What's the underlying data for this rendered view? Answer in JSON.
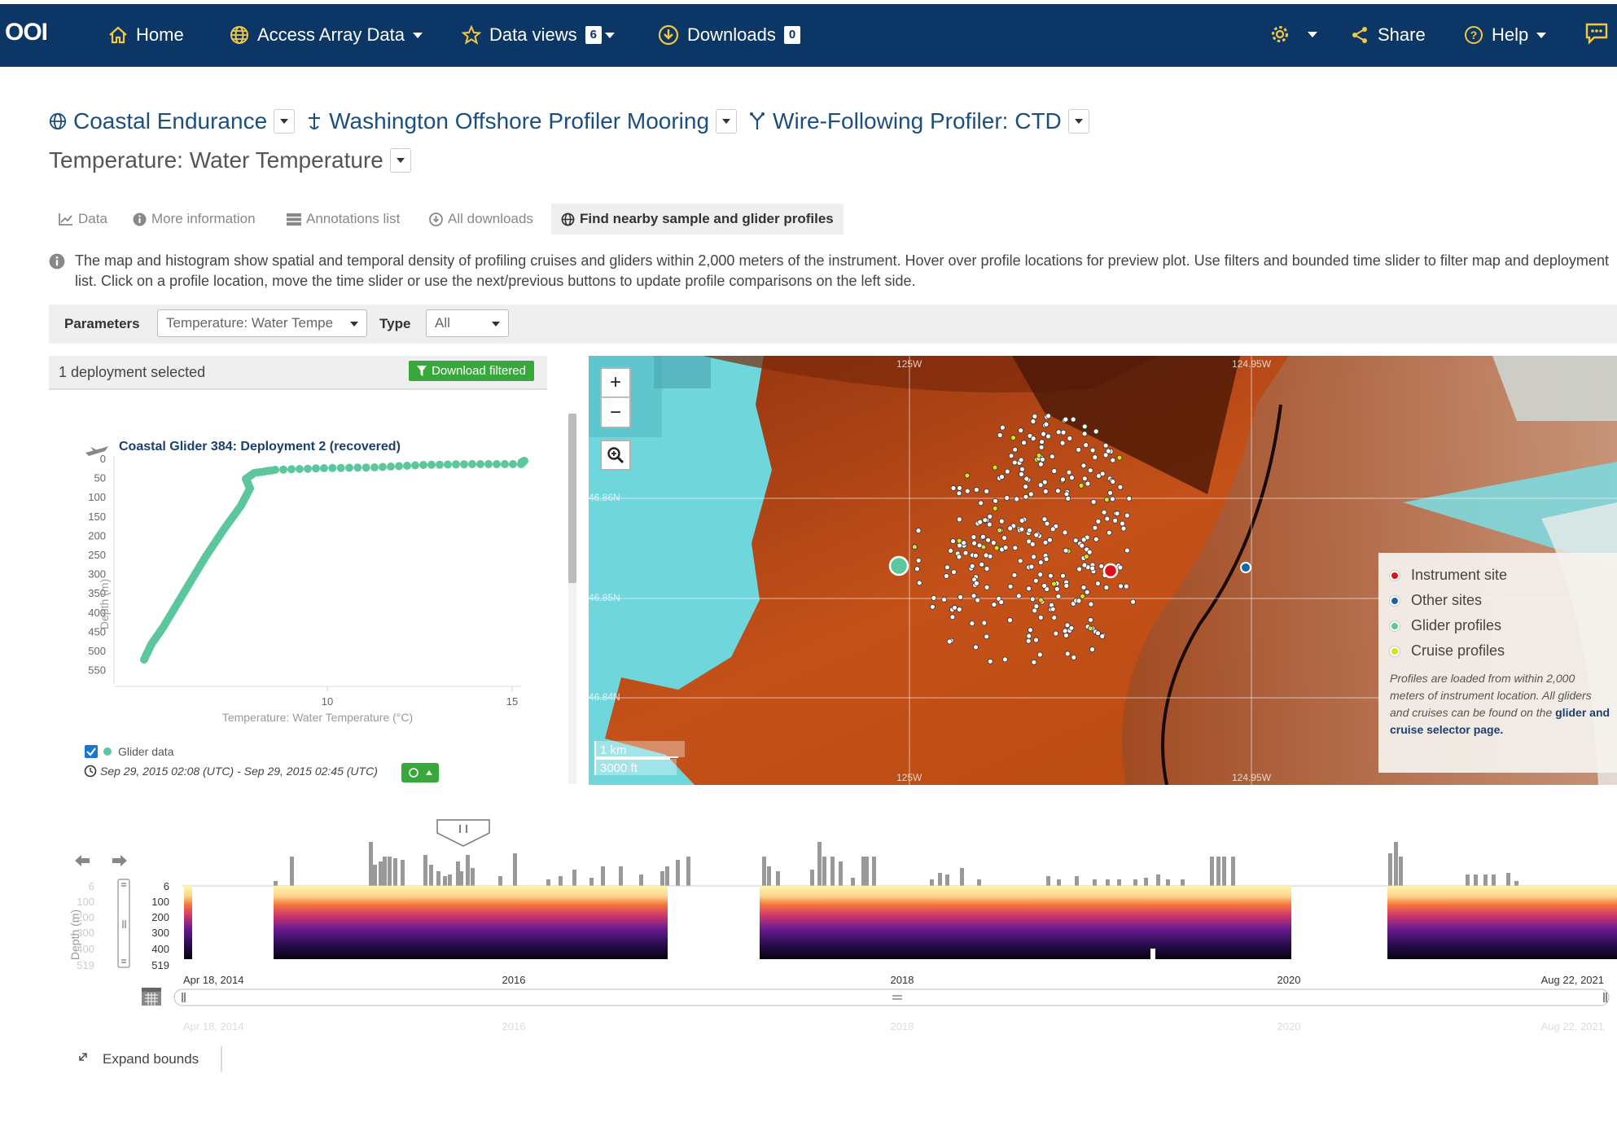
{
  "nav": {
    "logo": "OOI",
    "home": "Home",
    "access": "Access Array Data",
    "dataviews": "Data views",
    "dataviews_count": "6",
    "downloads": "Downloads",
    "downloads_count": "0",
    "share": "Share",
    "help": "Help",
    "icons": [
      "home-icon",
      "globe-icon",
      "star-icon",
      "download-icon",
      "gear-icon",
      "share-icon",
      "help-icon",
      "chat-icon"
    ]
  },
  "breadcrumb": {
    "site": "Coastal Endurance",
    "mooring": "Washington Offshore Profiler Mooring",
    "instrument": "Wire-Following Profiler: CTD",
    "parameter": "Temperature: Water Temperature"
  },
  "tabs": [
    "Data",
    "More information",
    "Annotations list",
    "All downloads",
    "Find nearby sample and glider profiles"
  ],
  "info": "The map and histogram show spatial and temporal density of profiling cruises and gliders within 2,000 meters of the instrument. Hover over profile locations for preview plot. Use filters and bounded time slider to filter map and deployment list. Click on a profile location, move the time slider or use the next/previous buttons to update profile comparisons on the left side.",
  "filters": {
    "parameters_label": "Parameters",
    "parameters_value": "Temperature: Water Tempe",
    "type_label": "Type",
    "type_value": "All"
  },
  "deployment": {
    "selected": "1 deployment selected",
    "download": "Download filtered"
  },
  "profile_plot": {
    "title": "Coastal Glider 384: Deployment 2 (recovered)",
    "ylabel": "Depth (m)",
    "xlabel": "Temperature: Water Temperature (°C)",
    "yticks": [
      "0",
      "50",
      "100",
      "150",
      "200",
      "250",
      "300",
      "350",
      "400",
      "450",
      "500",
      "550"
    ],
    "xticks": [
      "10",
      "15"
    ],
    "legend": "Glider data",
    "time_range": "Sep 29, 2015 02:08 (UTC) - Sep 29, 2015 02:45 (UTC)",
    "color": "#5cc79c"
  },
  "map": {
    "lon_labels": [
      "125W",
      "124.95W"
    ],
    "lat_labels": [
      "46.86N",
      "46.85N",
      "46.84N"
    ],
    "scale_km": "1 km",
    "scale_ft": "3000 ft",
    "zoom_in": "+",
    "zoom_out": "−",
    "legend": [
      {
        "label": "Instrument site",
        "color": "#e0101a"
      },
      {
        "label": "Other sites",
        "color": "#1565a8"
      },
      {
        "label": "Glider profiles",
        "color": "#5cc79c"
      },
      {
        "label": "Cruise profiles",
        "color": "#d6e21c"
      }
    ],
    "note_prefix": "Profiles are loaded from within 2,000 meters of instrument location. All gliders and cruises can be found on the ",
    "note_link": "glider and cruise selector page."
  },
  "timeline": {
    "depth_label": "Depth (m)",
    "depth_ticks": [
      "6",
      "100",
      "200",
      "300",
      "400",
      "519"
    ],
    "x_labels": [
      "Apr 18, 2014",
      "2016",
      "2018",
      "2020",
      "Aug 22, 2021"
    ],
    "expand": "Expand bounds"
  }
}
